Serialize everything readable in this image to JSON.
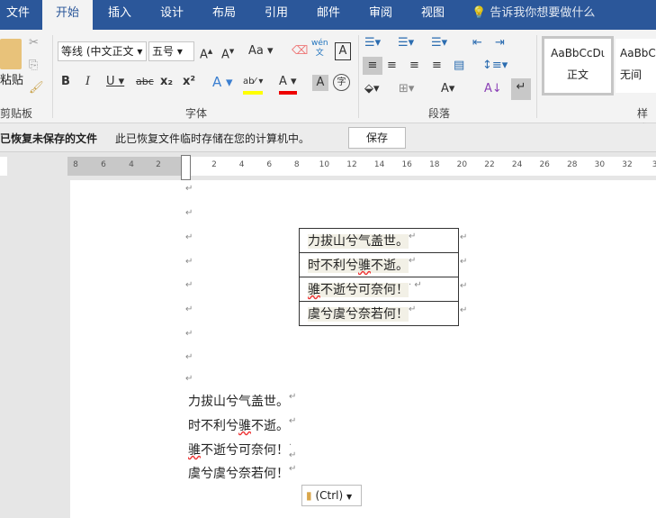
{
  "tabs": [
    "文件",
    "开始",
    "插入",
    "设计",
    "布局",
    "引用",
    "邮件",
    "审阅",
    "视图"
  ],
  "tell_me": "告诉我你想要做什么",
  "clipboard": {
    "paste": "粘贴",
    "group": "剪贴板"
  },
  "font": {
    "name": "等线 (中文正文",
    "size": "五号",
    "group": "字体",
    "case_btn": "Aa",
    "wen": "wén",
    "wen_char": "文",
    "char_border": "A",
    "bold": "B",
    "italic": "I",
    "underline": "U",
    "strike": "abc",
    "sub": "x₂",
    "sup": "x²",
    "enclose": "字"
  },
  "paragraph": {
    "group": "段落"
  },
  "styles": {
    "items": [
      "AaBbCcDι",
      "AaBbC"
    ],
    "names": [
      "正文",
      "无间"
    ],
    "group": "样式"
  },
  "infobar": {
    "title": "已恢复未保存的文件",
    "message": "此已恢复文件临时存储在您的计算机中。",
    "save": "保存"
  },
  "ruler": {
    "left": [
      "8",
      "6",
      "4",
      "2"
    ],
    "right": [
      "2",
      "4",
      "6",
      "8",
      "10",
      "12",
      "14",
      "16",
      "18",
      "20",
      "22",
      "24",
      "26",
      "28",
      "30",
      "32",
      "3"
    ]
  },
  "table_rows": [
    "力拔山兮气盖世。",
    "时不利兮骓不逝。",
    "骓不逝兮可奈何！",
    "虞兮虞兮奈若何！"
  ],
  "lines": [
    "力拔山兮气盖世。",
    "时不利兮骓不逝。",
    "骓不逝兮可奈何！",
    "虞兮虞兮奈若何！"
  ],
  "paste_options": "(Ctrl)",
  "colors": {
    "accent": "#2b579a",
    "highlight": "#ffff00",
    "font_color": "#e00000"
  }
}
